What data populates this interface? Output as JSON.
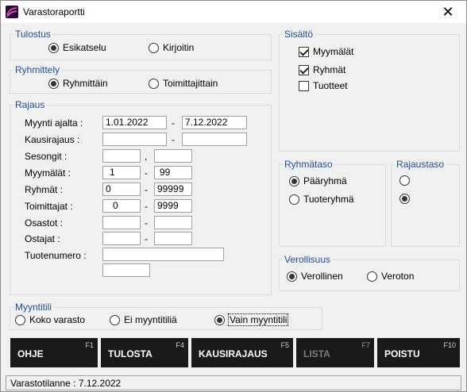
{
  "window": {
    "title": "Varastoraportti",
    "close_glyph": "✕",
    "icon": "app-icon"
  },
  "tulostus": {
    "title": "Tulostus",
    "options": [
      {
        "label": "Esikatselu",
        "selected": true
      },
      {
        "label": "Kirjoitin",
        "selected": false
      }
    ]
  },
  "ryhmittely": {
    "title": "Ryhmittely",
    "options": [
      {
        "label": "Ryhmittäin",
        "selected": true
      },
      {
        "label": "Toimittajittain",
        "selected": false
      }
    ]
  },
  "rajaus": {
    "title": "Rajaus",
    "myynti_ajalta": {
      "label": "Myynti ajalta :",
      "from": "1.01.2022",
      "to": "7.12.2022"
    },
    "kausirajaus": {
      "label": "Kausirajaus :",
      "from": "",
      "to": ""
    },
    "sesongit": {
      "label": "Sesongit :",
      "from": "",
      "to": "",
      "separator": ","
    },
    "myymalat": {
      "label": "Myymälät :",
      "from": "1",
      "to": "99"
    },
    "ryhmat": {
      "label": "Ryhmät :",
      "from": "0",
      "to": "99999"
    },
    "toimittajat": {
      "label": "Toimittajat :",
      "from": "0",
      "to": "9999"
    },
    "osastot": {
      "label": "Osastot :",
      "from": "",
      "to": ""
    },
    "ostajat": {
      "label": "Ostajat :",
      "from": "",
      "to": ""
    },
    "tuotenumero": {
      "label": "Tuotenumero :",
      "value": "",
      "value2": ""
    },
    "dash": "-"
  },
  "sisalto": {
    "title": "Sisältö",
    "options": [
      {
        "label": "Myymälät",
        "checked": true
      },
      {
        "label": "Ryhmät",
        "checked": true
      },
      {
        "label": "Tuotteet",
        "checked": false
      }
    ]
  },
  "ryhmataso": {
    "title": "Ryhmätaso",
    "options": [
      {
        "label": "Pääryhmä",
        "selected": true
      },
      {
        "label": "Tuoteryhmä",
        "selected": false
      }
    ]
  },
  "rajaustaso": {
    "title": "Rajaustaso",
    "options": [
      {
        "selected": false
      },
      {
        "selected": true
      }
    ]
  },
  "verollisuus": {
    "title": "Verollisuus",
    "options": [
      {
        "label": "Verollinen",
        "selected": true
      },
      {
        "label": "Veroton",
        "selected": false
      }
    ]
  },
  "myyntitili": {
    "title": "Myyntitili",
    "options": [
      {
        "label": "Koko varasto",
        "selected": false
      },
      {
        "label": "Ei myyntitiliä",
        "selected": false
      },
      {
        "label": "Vain myyntitili",
        "selected": true
      }
    ]
  },
  "buttons": [
    {
      "label": "OHJE",
      "key": "F1",
      "enabled": true
    },
    {
      "label": "TULOSTA",
      "key": "F4",
      "enabled": true
    },
    {
      "label": "KAUSIRAJAUS",
      "key": "F5",
      "enabled": true
    },
    {
      "label": "LISTA",
      "key": "F7",
      "enabled": false
    },
    {
      "label": "POISTU",
      "key": "F10",
      "enabled": true
    }
  ],
  "status": {
    "text": "Varastotilanne :  7.12.2022"
  }
}
